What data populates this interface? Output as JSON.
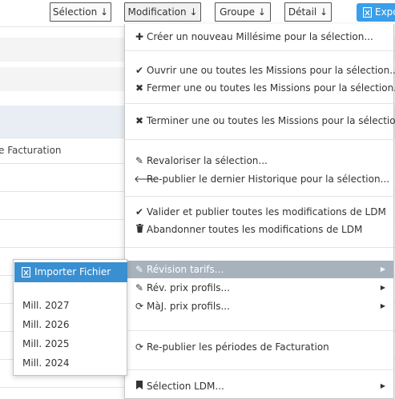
{
  "toolbar": {
    "selection_label": "Sélection ↓",
    "modification_label": "Modification ↓",
    "groupe_label": "Groupe ↓",
    "detail_label": "Détail ↓",
    "export_label": "Expo"
  },
  "table": {
    "column_header": "e Facturation"
  },
  "menu": {
    "items": [
      {
        "label": "Créer un nouveau Millésime pour la sélection...",
        "icon": "plus-icon"
      },
      {
        "label": "Ouvrir une ou toutes les Missions pour la sélection...",
        "icon": "check-icon"
      },
      {
        "label": "Fermer une ou toutes les Missions pour la sélection...",
        "icon": "close-icon"
      },
      {
        "label": "Terminer une ou toutes les Missions pour la sélection...",
        "icon": "close-icon"
      },
      {
        "label": "Revaloriser la sélection...",
        "icon": "pencil-icon"
      },
      {
        "label": "Re-publier le dernier Historique pour la sélection...",
        "icon": "arrow-left-icon"
      },
      {
        "label": "Valider et publier toutes les modifications de LDM",
        "icon": "check-icon"
      },
      {
        "label": "Abandonner toutes les modifications de LDM",
        "icon": "trash-icon"
      },
      {
        "label": "Révision tarifs...",
        "icon": "pencil-icon"
      },
      {
        "label": "Rév. prix profils...",
        "icon": "pencil-icon"
      },
      {
        "label": "MàJ. prix profils...",
        "icon": "refresh-icon"
      },
      {
        "label": "Re-publier les périodes de Facturation",
        "icon": "refresh-icon"
      },
      {
        "label": "Sélection LDM...",
        "icon": "bookmark-icon"
      }
    ]
  },
  "submenu": {
    "import_label": "Importer Fichier",
    "years": [
      "Mill. 2027",
      "Mill. 2026",
      "Mill. 2025",
      "Mill. 2024"
    ]
  },
  "colors": {
    "highlight": "#a7b2bd",
    "primary": "#3a8fd0",
    "export": "#3b9ee8"
  }
}
